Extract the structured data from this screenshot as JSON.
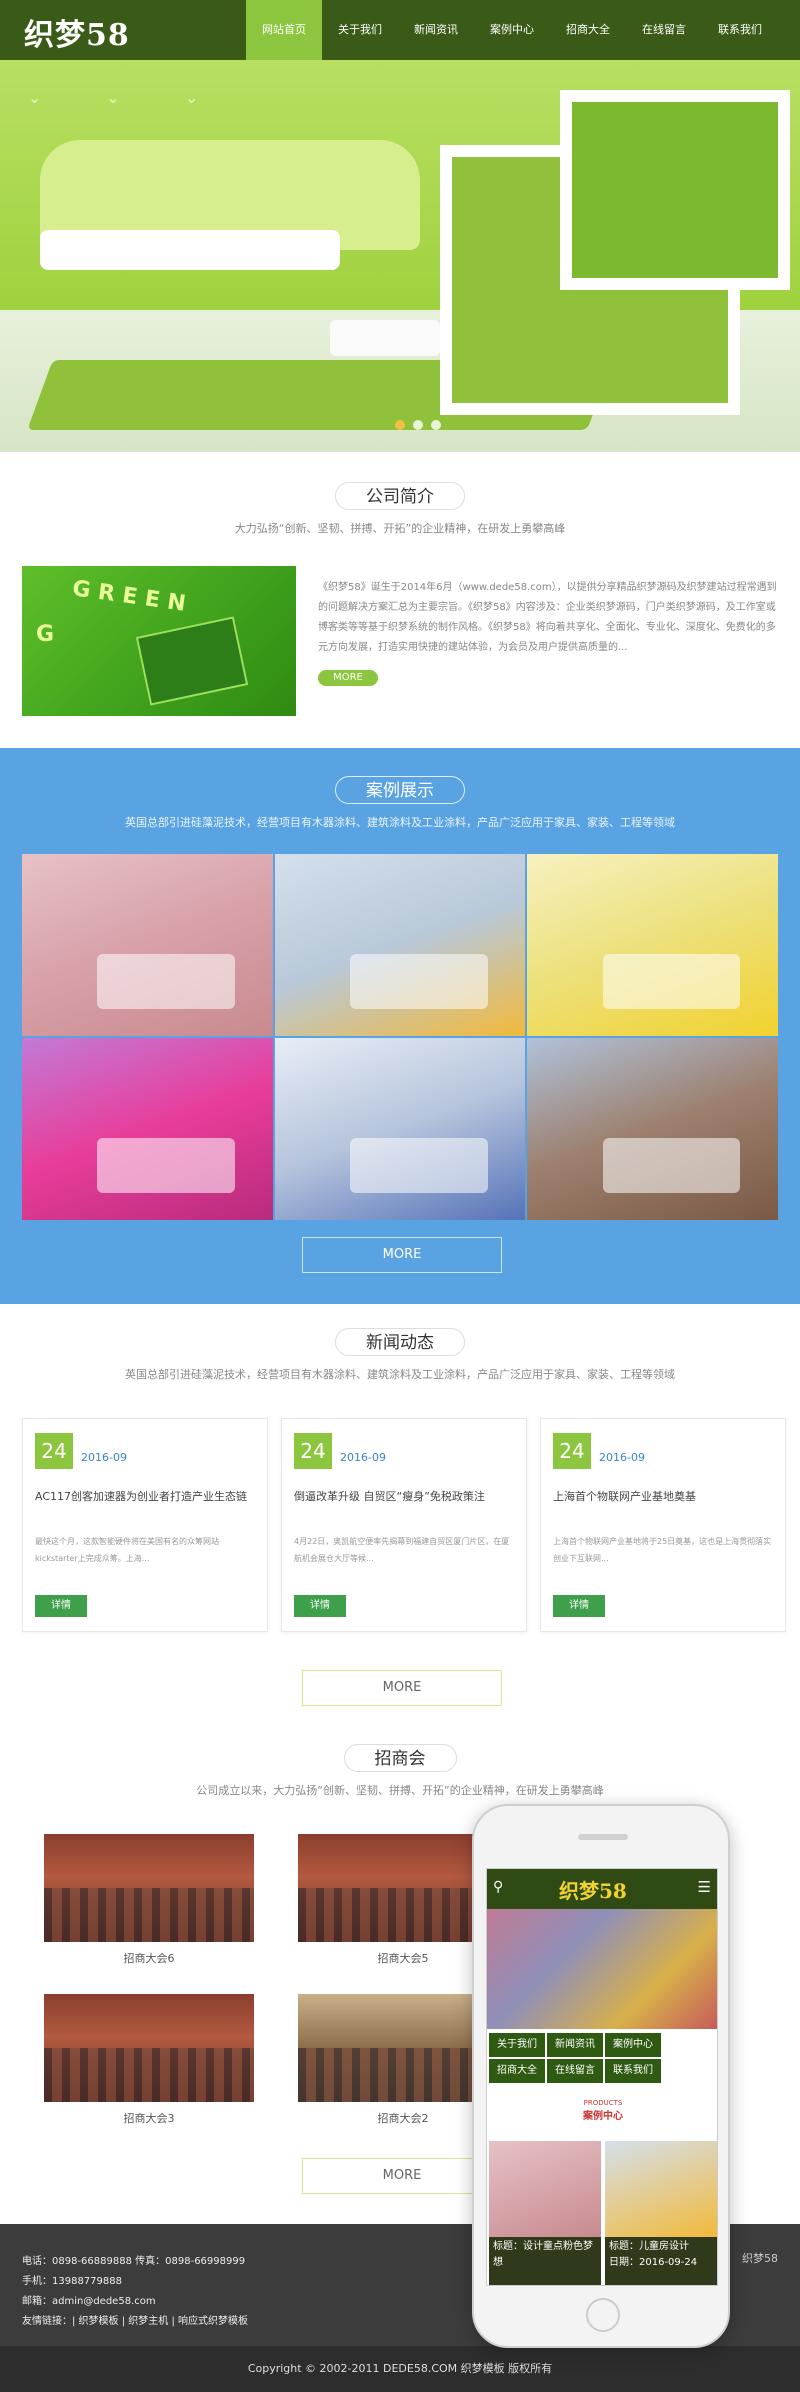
{
  "header": {
    "logo": "织梦58",
    "nav": [
      "网站首页",
      "关于我们",
      "新闻资讯",
      "案例中心",
      "招商大全",
      "在线留言",
      "联系我们"
    ]
  },
  "banner": {
    "arrows": "⌄ ⌄ ⌄",
    "active_slide": 1,
    "slide_count": 3
  },
  "about": {
    "title": "公司简介",
    "subtitle": "大力弘扬“创新、坚韧、拼搏、开拓”的企业精神，在研发上勇攀高峰",
    "text": "《织梦58》诞生于2014年6月（www.dede58.com），以提供分享精品织梦源码及织梦建站过程常遇到的问题解决方案汇总为主要宗旨。《织梦58》内容涉及：企业类织梦源码，门户类织梦源码，及工作室或博客类等等基于织梦系统的制作风格。《织梦58》将向着共享化、全面化、专业化、深度化、免费化的多元方向发展，打造实用快捷的建站体验，为会员及用户提供高质量的...",
    "more": "MORE"
  },
  "cases": {
    "title": "案例展示",
    "subtitle": "英国总部引进硅藻泥技术，经营项目有木器涂料、建筑涂料及工业涂料，产品广泛应用于家具、家装、工程等领域",
    "more": "MORE"
  },
  "news": {
    "title": "新闻动态",
    "subtitle": "英国总部引进硅藻泥技术，经营项目有木器涂料、建筑涂料及工业涂料，产品广泛应用于家具、家装、工程等领域",
    "items": [
      {
        "day": "24",
        "date": "2016-09",
        "title": "AC117创客加速器为创业者打造产业生态链",
        "summary": "最快这个月，这款智能硬件将在美国有名的众筹网站kickstarter上完成众筹。上海...",
        "btn": "详情"
      },
      {
        "day": "24",
        "date": "2016-09",
        "title": "倒逼改革升级 自贸区“瘦身”免税政策注",
        "summary": "4月22日，奥凯航空便率先揭幕到福建自贸区厦门片区，在厦航机会展仓大厅等候...",
        "btn": "详情"
      },
      {
        "day": "24",
        "date": "2016-09",
        "title": "上海首个物联网产业基地奠基",
        "summary": "上海首个物联网产业基地将于25日奠基，这也是上海贯彻落实创业下互联网...",
        "btn": "详情"
      }
    ],
    "more": "MORE"
  },
  "zhaoshang": {
    "title": "招商会",
    "subtitle": "公司成立以来，大力弘扬“创新、坚韧、拼搏、开拓”的企业精神，在研发上勇攀高峰",
    "items": [
      "招商大会6",
      "招商大会5",
      "招商大会3",
      "招商大会2"
    ],
    "more": "MORE"
  },
  "footer": {
    "phone": "电话：0898-66889888    传真：0898-66998999",
    "mobile": "手机：13988779888",
    "email": "邮箱：admin@dede58.com",
    "links": "友情链接：| 织梦模板 | 织梦主机 | 响应式织梦模板",
    "brand": "织梦58",
    "copyright": "Copyright © 2002-2011 DEDE58.COM 织梦模板 版权所有"
  },
  "phone": {
    "logo": "织梦58",
    "nav": [
      "关于我们",
      "新闻资讯",
      "案例中心",
      "招商大全",
      "在线留言",
      "联系我们"
    ],
    "products_en": "PRODUCTS",
    "products_cn": "案例中心",
    "cases": [
      {
        "title": "标题：设计童点粉色梦想"
      },
      {
        "title": "标题：儿童房设计",
        "date": "日期：2016-09-24"
      }
    ]
  }
}
